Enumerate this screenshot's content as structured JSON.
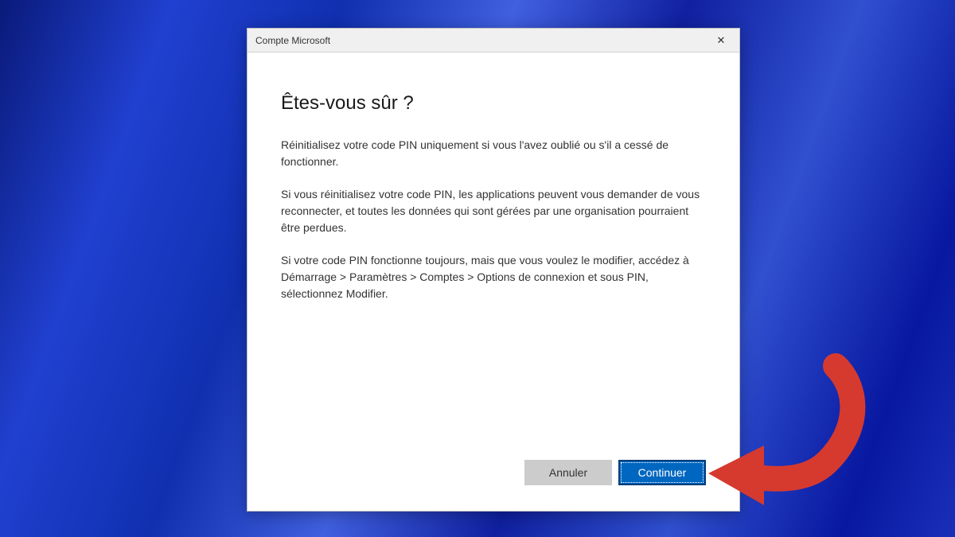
{
  "titlebar": {
    "title": "Compte Microsoft"
  },
  "dialog": {
    "heading": "Êtes-vous sûr ?",
    "paragraph1": "Réinitialisez votre code PIN uniquement si vous l'avez oublié ou s'il a cessé de fonctionner.",
    "paragraph2": "Si vous réinitialisez votre code PIN, les applications peuvent vous demander de vous reconnecter, et toutes les données qui sont gérées par une organisation pourraient être perdues.",
    "paragraph3": "Si votre code PIN fonctionne toujours, mais que vous voulez le modifier, accédez à Démarrage > Paramètres > Comptes > Options de connexion et sous PIN, sélectionnez Modifier."
  },
  "buttons": {
    "cancel": "Annuler",
    "continue": "Continuer"
  }
}
